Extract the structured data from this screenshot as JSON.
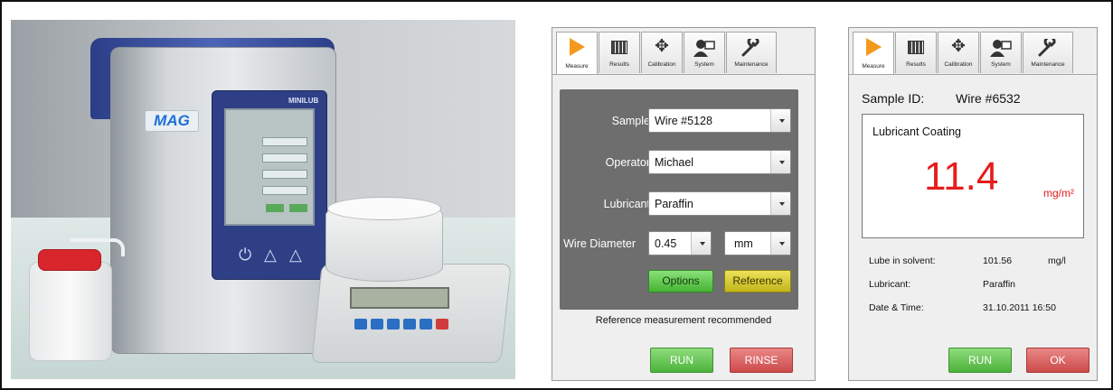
{
  "photo": {
    "brand_logo": "MAG",
    "model_logo": "MINILUB"
  },
  "tabs": [
    {
      "label": "Measure",
      "icon": "play-icon"
    },
    {
      "label": "Results",
      "icon": "results-grid-icon"
    },
    {
      "label": "Calibration",
      "icon": "calibration-move-icon"
    },
    {
      "label": "System",
      "icon": "system-user-icon"
    },
    {
      "label": "Maintenance",
      "icon": "wrench-icon"
    }
  ],
  "measure_form": {
    "sample_label": "Sample",
    "sample_value": "Wire #5128",
    "operator_label": "Operator",
    "operator_value": "Michael",
    "lubricant_label": "Lubricant",
    "lubricant_value": "Paraffin",
    "wire_diameter_label": "Wire Diameter",
    "wire_diameter_value": "0.45",
    "wire_diameter_unit": "mm",
    "options_button": "Options",
    "reference_button": "Reference",
    "message": "Reference measurement recommended",
    "run_button": "RUN",
    "rinse_button": "RINSE"
  },
  "results": {
    "sample_id_label": "Sample ID:",
    "sample_id_value": "Wire #6532",
    "coating_title": "Lubricant Coating",
    "coating_value": "11.4",
    "coating_unit": "mg/m²",
    "lube_in_solvent_label": "Lube in solvent:",
    "lube_in_solvent_value": "101.56",
    "lube_in_solvent_unit": "mg/l",
    "lubricant_label": "Lubricant:",
    "lubricant_value": "Paraffin",
    "datetime_label": "Date & Time:",
    "datetime_value": "31.10.2011 16:50",
    "run_button": "RUN",
    "ok_button": "OK"
  },
  "colors": {
    "accent_orange": "#f39a1d",
    "run_green": "#4cb33a",
    "rinse_red": "#cc4a4a",
    "result_red": "#e51d1d",
    "form_gray": "#6e6e6e"
  }
}
